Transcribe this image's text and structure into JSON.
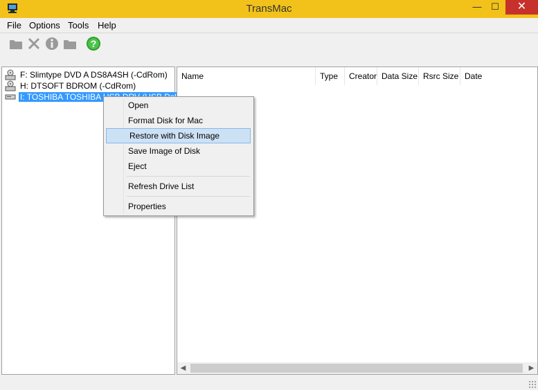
{
  "window": {
    "title": "TransMac",
    "minimize_glyph": "—",
    "maximize_glyph": "☐",
    "close_glyph": "✕",
    "accent": "#f2c21a"
  },
  "menubar": {
    "items": [
      {
        "label": "File"
      },
      {
        "label": "Options"
      },
      {
        "label": "Tools"
      },
      {
        "label": "Help"
      }
    ]
  },
  "toolbar": {
    "buttons": [
      {
        "icon": "folder-icon",
        "enabled": false
      },
      {
        "icon": "delete-icon",
        "enabled": false
      },
      {
        "icon": "info-icon",
        "enabled": false
      },
      {
        "icon": "folder-open-icon",
        "enabled": false
      },
      {
        "icon": "help-icon",
        "enabled": true
      }
    ]
  },
  "tree": {
    "items": [
      {
        "label": "F: Slimtype DVD A  DS8A4SH (-CdRom)",
        "icon": "cdrom-drive-icon"
      },
      {
        "label": "H: DTSOFT BDROM (-CdRom)",
        "icon": "cdrom-drive-icon"
      },
      {
        "label": "I: TOSHIBA TOSHIBA USB DRV (USB Dsk)",
        "icon": "usb-drive-icon",
        "selected": true
      }
    ]
  },
  "list": {
    "columns": [
      "Name",
      "Type",
      "Creator",
      "Data Size",
      "Rsrc Size",
      "Date"
    ]
  },
  "context_menu": {
    "items": [
      {
        "label": "Open"
      },
      {
        "label": "Format Disk for Mac"
      },
      {
        "label": "Restore with Disk Image",
        "highlighted": true
      },
      {
        "label": "Save Image of Disk"
      },
      {
        "label": "Eject"
      },
      {
        "label": "Refresh Drive List"
      },
      {
        "label": "Properties"
      }
    ]
  }
}
